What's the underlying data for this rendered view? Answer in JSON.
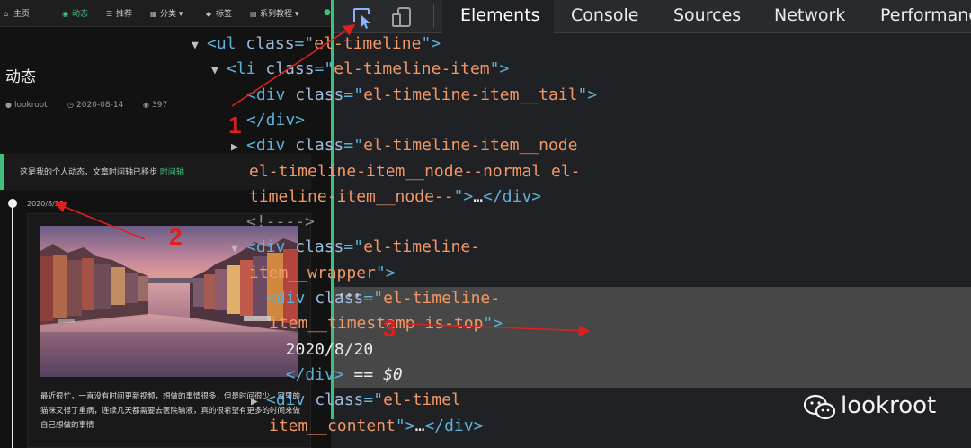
{
  "website": {
    "nav": [
      {
        "icon": "home-icon",
        "label": "主页",
        "active": false
      },
      {
        "icon": "activity-icon",
        "label": "动态",
        "active": true
      },
      {
        "icon": "list-icon",
        "label": "推荐",
        "active": false
      },
      {
        "icon": "grid-icon",
        "label": "分类",
        "active": false,
        "caret": "▾"
      },
      {
        "icon": "tag-icon",
        "label": "标签",
        "active": false
      },
      {
        "icon": "book-icon",
        "label": "系列教程",
        "active": false,
        "caret": "▾"
      }
    ],
    "page_title": "动态",
    "meta": {
      "author": "lookroot",
      "date": "2020-08-14",
      "views": "397"
    },
    "notice": {
      "text": "这是我的个人动态，文章时间轴已移步 ",
      "link": "时间轴"
    },
    "timeline": {
      "timestamp": "2020/8/30",
      "post_text": "最近很忙，一直没有时间更新视频，想做的事情很多，但是时间很少，家里的猫咪又得了重病，连续几天都需要去医院输液，真的很希望有更多的时间来做自己想做的事情"
    }
  },
  "devtools": {
    "tabs": [
      "Elements",
      "Console",
      "Sources",
      "Network",
      "Performanc"
    ],
    "active_tab": "Elements",
    "dom_lines": [
      {
        "indent": 0,
        "arrow": "▼",
        "parts": [
          [
            "tg",
            "<ul "
          ],
          [
            "an",
            "class"
          ],
          [
            "tg",
            "=\""
          ],
          [
            "av",
            "el-timeline"
          ],
          [
            "tg",
            "\">"
          ]
        ]
      },
      {
        "indent": 1,
        "arrow": "▼",
        "parts": [
          [
            "tg",
            "<li "
          ],
          [
            "an",
            "class"
          ],
          [
            "tg",
            "=\""
          ],
          [
            "av",
            "el-timeline-item"
          ],
          [
            "tg",
            "\">"
          ]
        ]
      },
      {
        "indent": 2,
        "arrow": "",
        "parts": [
          [
            "tg",
            "<div "
          ],
          [
            "an",
            "class"
          ],
          [
            "tg",
            "=\""
          ],
          [
            "av",
            "el-timeline-item__tail"
          ],
          [
            "tg",
            "\">"
          ]
        ]
      },
      {
        "indent": 2,
        "arrow": "",
        "parts": [
          [
            "tg",
            "</div>"
          ]
        ]
      },
      {
        "indent": 2,
        "arrow": "▶",
        "parts": [
          [
            "tg",
            "<div "
          ],
          [
            "an",
            "class"
          ],
          [
            "tg",
            "=\""
          ],
          [
            "av",
            "el-timeline-item__node"
          ]
        ]
      },
      {
        "indent": 1,
        "arrow": "",
        "wrap": true,
        "parts": [
          [
            "av",
            "el-timeline-item__node--normal el-"
          ]
        ]
      },
      {
        "indent": 1,
        "arrow": "",
        "wrap": true,
        "parts": [
          [
            "av",
            "timeline-item__node--"
          ],
          [
            "tg",
            "\">"
          ],
          [
            "tx",
            "…"
          ],
          [
            "tg",
            "</div>"
          ]
        ]
      },
      {
        "indent": 2,
        "arrow": "",
        "parts": [
          [
            "cm",
            "<!---->"
          ]
        ]
      },
      {
        "indent": 2,
        "arrow": "▼",
        "parts": [
          [
            "tg",
            "<div "
          ],
          [
            "an",
            "class"
          ],
          [
            "tg",
            "=\""
          ],
          [
            "av",
            "el-timeline-"
          ]
        ]
      },
      {
        "indent": 1,
        "arrow": "",
        "wrap": true,
        "parts": [
          [
            "av",
            "item__wrapper"
          ],
          [
            "tg",
            "\">"
          ]
        ]
      },
      {
        "indent": 3,
        "arrow": "",
        "parts": [
          [
            "tg",
            "<div "
          ],
          [
            "an",
            "class"
          ],
          [
            "tg",
            "=\""
          ],
          [
            "av",
            "el-timeline-"
          ]
        ]
      },
      {
        "indent": 2,
        "arrow": "",
        "wrap": true,
        "parts": [
          [
            "av",
            "item__timestamp is-top"
          ],
          [
            "tg",
            "\">"
          ]
        ]
      },
      {
        "indent": 3,
        "arrow": "",
        "parts": [
          [
            "tx",
            "  2020/8/20"
          ]
        ]
      },
      {
        "indent": 3,
        "arrow": "",
        "parts": [
          [
            "tg",
            "  </div>"
          ],
          [
            "tx",
            " == "
          ],
          [
            "tx",
            "$0"
          ]
        ]
      },
      {
        "indent": 3,
        "arrow": "▶",
        "parts": [
          [
            "tg",
            "<div "
          ],
          [
            "an",
            "class"
          ],
          [
            "tg",
            "=\""
          ],
          [
            "av",
            "el-timel"
          ]
        ]
      },
      {
        "indent": 2,
        "arrow": "",
        "wrap": true,
        "parts": [
          [
            "av",
            "item__content"
          ],
          [
            "tg",
            "\">"
          ],
          [
            "tx",
            "…"
          ],
          [
            "tg",
            "</div>"
          ]
        ]
      }
    ]
  },
  "annotations": [
    "1",
    "2",
    "3"
  ],
  "watermark": "lookroot",
  "colors": {
    "accent": "#3fbf7f",
    "annotation": "#e01e1e",
    "selected_row": "#474747"
  }
}
